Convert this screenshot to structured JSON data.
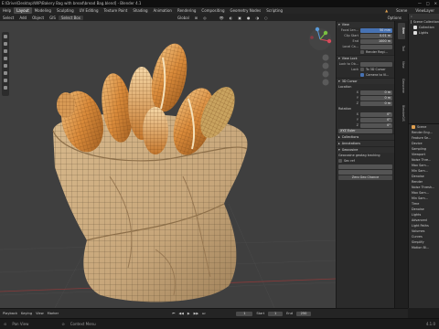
{
  "titlebar": {
    "path": "E:\\Drive\\Desktop\\WIP\\Bakery Bag with bread\\bread Bag.blend] - Blender 4.1"
  },
  "menubar": {
    "items": [
      "Help",
      "Layout",
      "Modeling",
      "Sculpting",
      "UV Editing",
      "Texture Paint",
      "Shading",
      "Animation",
      "Rendering",
      "Compositing",
      "Geometry Nodes",
      "Scripting"
    ],
    "active": "Layout",
    "scene_label": "Scene",
    "view_layer_label": "ViewLayer"
  },
  "header": {
    "items": [
      "Select",
      "Add",
      "Object",
      "GIS",
      "Select Box"
    ],
    "orientation": "Global",
    "options": "Options"
  },
  "npanel": {
    "view_header": "View",
    "focal_length": {
      "label": "Focal Len...",
      "value": "50 mm"
    },
    "clip_start": {
      "label": "Clip Start",
      "value": "0.01 m"
    },
    "clip_end": {
      "label": "End",
      "value": "1000 m"
    },
    "local_camera": {
      "label": "Local Ca...",
      "value": ""
    },
    "render_region": "Render Regi...",
    "view_lock_header": "View Lock",
    "lock_to_object": {
      "label": "Lock to Ob...",
      "value": ""
    },
    "lock": {
      "label": "Lock",
      "opt1": "To 3D Cursor",
      "opt2": "Camera to Vi..."
    },
    "cursor_header": "3D Cursor",
    "location_label": "Location",
    "loc": [
      {
        "axis": "X",
        "value": "0 m"
      },
      {
        "axis": "Y",
        "value": "0 m"
      },
      {
        "axis": "Z",
        "value": "0 m"
      }
    ],
    "rotation_label": "Rotation",
    "rot": [
      {
        "axis": "X",
        "value": "0°"
      },
      {
        "axis": "Y",
        "value": "0°"
      },
      {
        "axis": "Z",
        "value": "0°"
      }
    ],
    "rot_mode": "XYZ Euler",
    "collections": "Collections",
    "annotations": "Annotations",
    "gecosine": "Geocosine",
    "geo_tags": "Geocosine geotag tracking",
    "sec_ref": "Sec ref",
    "zero_btn": "Zero Geo Chance"
  },
  "ntabs": [
    "Item",
    "Tool",
    "View",
    "Geoscene",
    "BlenderGIS"
  ],
  "outliner": {
    "items": [
      "Scene Collection",
      "Collection",
      "Lights"
    ]
  },
  "props": {
    "items": [
      "Scene",
      "Render Eng...",
      "Feature Se...",
      "Device",
      "Sampling",
      "Viewport",
      "Noise Thre...",
      "Max Sam...",
      "Min Sam...",
      "Denoise",
      "Render",
      "Noise Thresh...",
      "Max Sam...",
      "Min Sam...",
      "Time",
      "Denoise",
      "Lights",
      "Advanced",
      "Light Paths",
      "Volumes",
      "Curves",
      "Simplify",
      "Motion Bl..."
    ]
  },
  "timeline": {
    "playback": "Playback",
    "keying": "Keying",
    "view": "View",
    "marker": "Marker",
    "current_frame": "1",
    "start_label": "Start",
    "start": "1",
    "end_label": "End",
    "end": "250"
  },
  "status": {
    "left": "Pan View",
    "mid": "Context Menu",
    "version": "4.1.0"
  }
}
